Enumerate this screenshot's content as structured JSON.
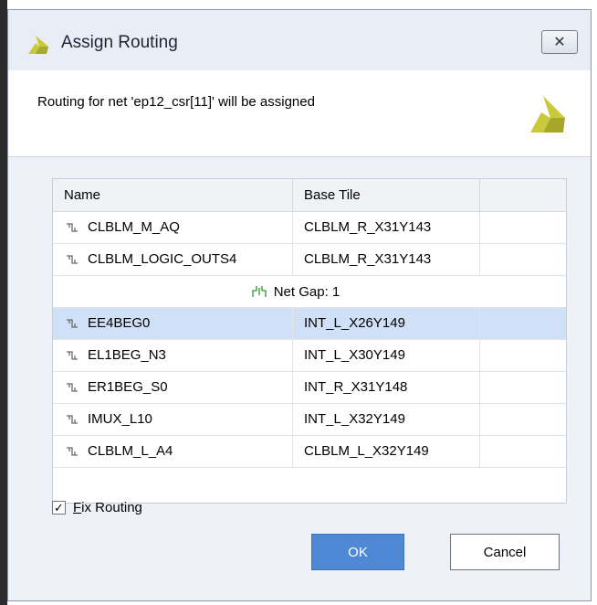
{
  "window": {
    "title": "Assign Routing",
    "close_glyph": "✕"
  },
  "header": {
    "message": "Routing for net 'ep12_csr[11]' will be assigned"
  },
  "table": {
    "columns": [
      "Name",
      "Base Tile"
    ],
    "rows_before_gap": [
      {
        "name": "CLBLM_M_AQ",
        "tile": "CLBLM_R_X31Y143"
      },
      {
        "name": "CLBLM_LOGIC_OUTS4",
        "tile": "CLBLM_R_X31Y143"
      }
    ],
    "gap_label": "Net Gap: 1",
    "rows_after_gap": [
      {
        "name": "EE4BEG0",
        "tile": "INT_L_X26Y149",
        "selected": true
      },
      {
        "name": "EL1BEG_N3",
        "tile": "INT_L_X30Y149"
      },
      {
        "name": "ER1BEG_S0",
        "tile": "INT_R_X31Y148"
      },
      {
        "name": "IMUX_L10",
        "tile": "INT_L_X32Y149"
      },
      {
        "name": "CLBLM_L_A4",
        "tile": "CLBLM_L_X32Y149"
      }
    ]
  },
  "fix_routing": {
    "label": "Fix Routing",
    "mnemonic": "F",
    "checked": true,
    "check_glyph": "✓"
  },
  "buttons": {
    "ok": "OK",
    "cancel": "Cancel"
  },
  "icons": {
    "logo": "vivado-logo-icon",
    "node": "routing-node-icon",
    "gap": "net-gap-icon"
  },
  "colors": {
    "selected_row": "#cfe0f7",
    "ok_button": "#4f89d6",
    "logo_yellow": "#c8c832",
    "gap_icon_green": "#2a9a2a"
  }
}
